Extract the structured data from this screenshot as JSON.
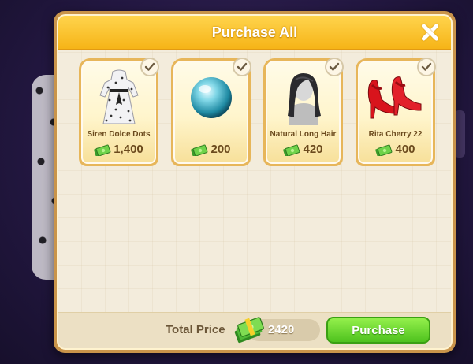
{
  "dialog": {
    "title": "Purchase All"
  },
  "items": [
    {
      "name": "Siren Dolce Dots",
      "price": "1,400",
      "art_icon": "polka-dot-dress-icon",
      "selected": true
    },
    {
      "name": "",
      "price": "200",
      "art_icon": "teal-orb-icon",
      "selected": true
    },
    {
      "name": "Natural Long Hair",
      "price": "420",
      "art_icon": "long-hair-icon",
      "selected": true
    },
    {
      "name": "Rita Cherry 22",
      "price": "400",
      "art_icon": "red-heels-icon",
      "selected": true
    }
  ],
  "footer": {
    "total_label": "Total Price",
    "total_value": "2420",
    "purchase_label": "Purchase"
  },
  "colors": {
    "header": "#f6b417",
    "purchase_button": "#4ec21e",
    "card_border": "#e7b65a"
  }
}
